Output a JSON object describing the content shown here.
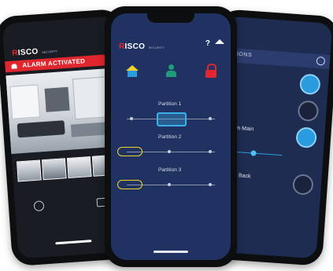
{
  "left_phone": {
    "brand": {
      "prefix": "R",
      "rest": "ISCO"
    },
    "brand_sub": "SECURITY",
    "alarm_label": "ALARM ACTIVATED",
    "alarm_icon": "siren-icon",
    "thumbnail_count": 4,
    "actions_icons": [
      "at-icon",
      "camera-icon"
    ]
  },
  "center_phone": {
    "brand": {
      "prefix": "R",
      "rest": "ISCO"
    },
    "brand_sub": "SECURITY",
    "header_icons": [
      "help-icon",
      "home-icon"
    ],
    "top_icons": [
      "house-armed-icon",
      "person-partial-icon",
      "lock-icon"
    ],
    "partitions": [
      {
        "title": "Partition 1",
        "state": "center"
      },
      {
        "title": "Partition 2",
        "state": "left"
      },
      {
        "title": "Partition 3",
        "state": "left"
      }
    ],
    "accent_color": "#3bb0e8",
    "pill_color": "#f2d32c"
  },
  "right_phone": {
    "header_fragment": "MATIONS",
    "list_fragments": [
      "nce",
      "en",
      "g Room Main",
      "g Room Back"
    ],
    "toggle_states": [
      true,
      false,
      true,
      false
    ]
  }
}
